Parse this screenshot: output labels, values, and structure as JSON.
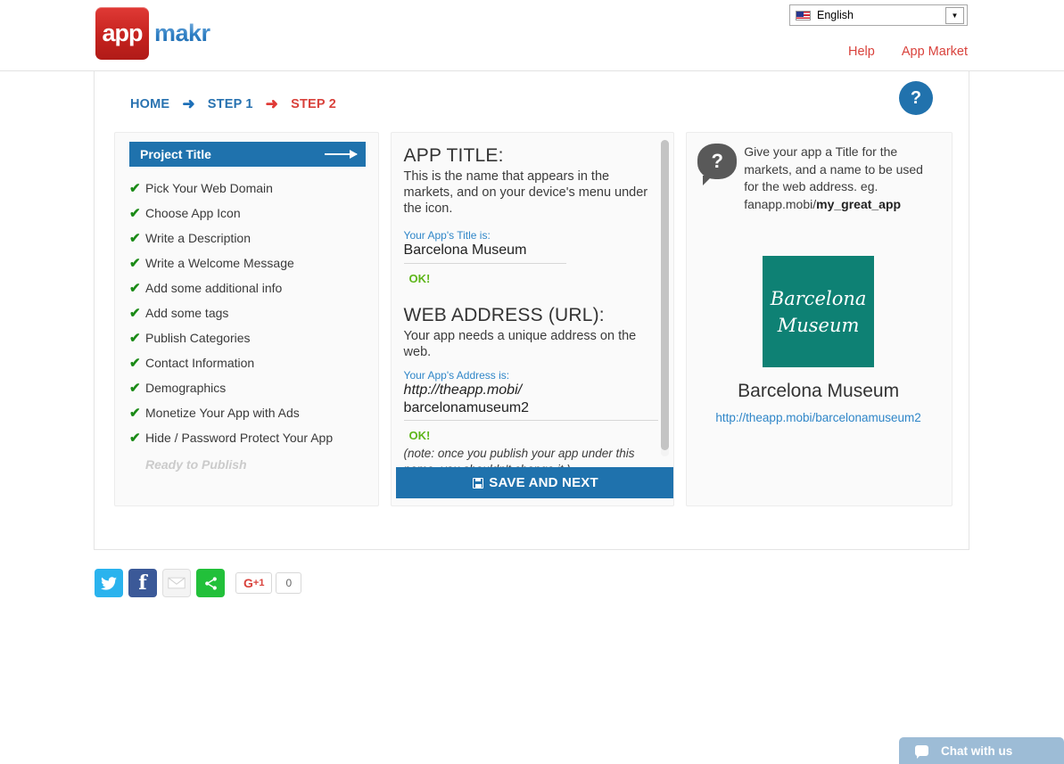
{
  "header": {
    "logo_app": "app",
    "logo_makr": "makr",
    "language": "English",
    "language_icon": "us-flag-icon",
    "caret_icon": "▼",
    "links": [
      {
        "label": "Help"
      },
      {
        "label": "App Market"
      }
    ]
  },
  "breadcrumb": {
    "home": "HOME",
    "arrow1": "➜",
    "step1": "STEP 1",
    "arrow2": "➜",
    "step2": "STEP 2"
  },
  "help_fab": {
    "label": "?"
  },
  "sidebar": {
    "active_step": "Project Title",
    "items": [
      {
        "label": "Pick Your Web Domain",
        "done": true
      },
      {
        "label": "Choose App Icon",
        "done": true
      },
      {
        "label": "Write a Description",
        "done": true
      },
      {
        "label": "Write a Welcome Message",
        "done": true
      },
      {
        "label": "Add some additional info",
        "done": true
      },
      {
        "label": "Add some tags",
        "done": true
      },
      {
        "label": "Publish Categories",
        "done": true
      },
      {
        "label": "Contact Information",
        "done": true
      },
      {
        "label": "Demographics",
        "done": true
      },
      {
        "label": "Monetize Your App with Ads",
        "done": true
      },
      {
        "label": "Hide / Password Protect Your App",
        "done": true
      }
    ],
    "ready_label": "Ready to Publish",
    "check_glyph": "✔"
  },
  "form": {
    "title_heading": "APP TITLE:",
    "title_desc": "This is the name that appears in the markets, and on your device's menu under the icon.",
    "title_field_label": "Your App's Title is:",
    "title_value": "Barcelona Museum",
    "title_status": "OK!",
    "url_heading": "WEB ADDRESS (URL):",
    "url_desc": "Your app needs a unique address on the web.",
    "url_field_label": "Your App's Address is:",
    "url_prefix": "http://theapp.mobi/",
    "url_value": "barcelonamuseum2",
    "url_status": "OK!",
    "url_note": "(note: once you publish your app under this name, you shouldn't change it.)",
    "save_label": "SAVE AND NEXT",
    "save_icon": "floppy-disk-icon"
  },
  "preview": {
    "hint_icon": "question-bubble-icon",
    "hint_text": "Give your app a Title for the markets, and a name to be used for the web address. eg. fanapp.mobi/",
    "hint_example": "my_great_app",
    "icon_line1": "Barcelona",
    "icon_line2": "Museum",
    "icon_color": "#0e8174",
    "app_name": "Barcelona Museum",
    "app_url_base": "http://theapp.mobi/",
    "app_url_slug": "barcelonamuseum2"
  },
  "share": {
    "twitter_icon": "twitter-bird-icon",
    "facebook_icon": "facebook-f-icon",
    "email_icon": "envelope-icon",
    "share_icon": "share-nodes-icon",
    "gplus_label": "G",
    "gplus_suffix": "+1",
    "gplus_count": "0"
  },
  "chat": {
    "label": "Chat with us",
    "icon": "chat-bubble-icon"
  },
  "colors": {
    "brand_blue": "#1f72ad",
    "brand_red": "#d9423c",
    "ok_green": "#5eb61a",
    "teal": "#0e8174"
  }
}
